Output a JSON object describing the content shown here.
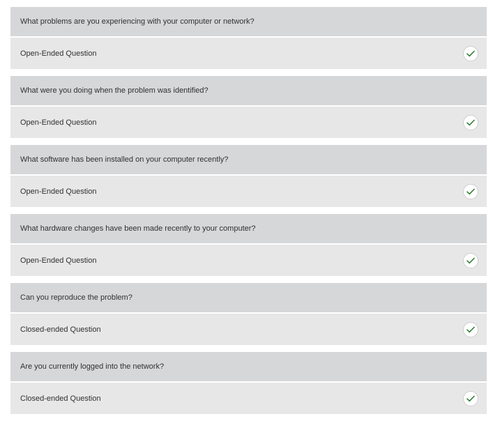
{
  "accent_color": "#2e7d32",
  "items": [
    {
      "question": "What problems are you experiencing with your computer or network?",
      "answer": "Open-Ended Question",
      "status_icon": "check-icon"
    },
    {
      "question": "What were you doing when the problem was identified?",
      "answer": "Open-Ended Question",
      "status_icon": "check-icon"
    },
    {
      "question": "What software has been installed on your computer recently?",
      "answer": "Open-Ended Question",
      "status_icon": "check-icon"
    },
    {
      "question": "What hardware changes have been made recently to your computer?",
      "answer": "Open-Ended Question",
      "status_icon": "check-icon"
    },
    {
      "question": "Can you reproduce the problem?",
      "answer": "Closed-ended Question",
      "status_icon": "check-icon"
    },
    {
      "question": "Are you currently logged into the network?",
      "answer": "Closed-ended Question",
      "status_icon": "check-icon"
    }
  ]
}
